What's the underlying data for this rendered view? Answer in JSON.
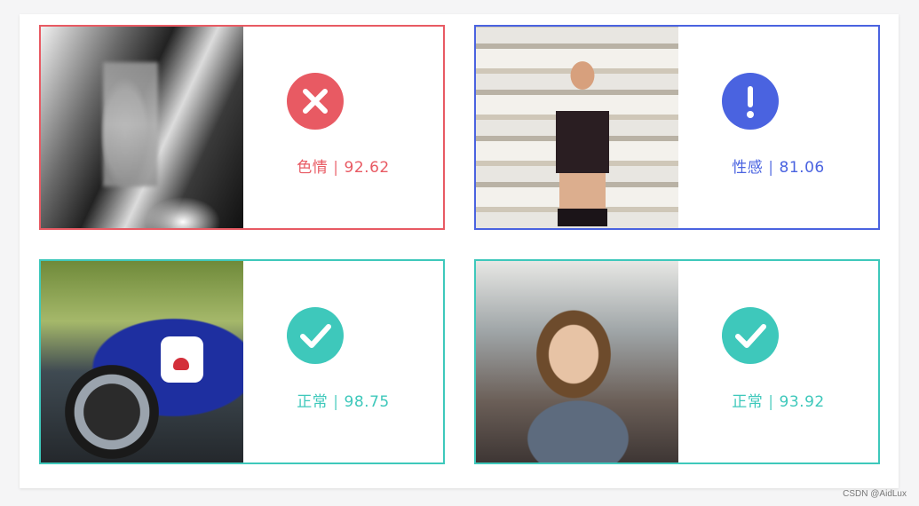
{
  "cards": [
    {
      "label": "色情",
      "separator": "|",
      "score": "92.62",
      "status_icon": "close-icon",
      "color": "#e85a63"
    },
    {
      "label": "性感",
      "separator": "|",
      "score": "81.06",
      "status_icon": "exclamation-icon",
      "color": "#4a63e0"
    },
    {
      "label": "正常",
      "separator": "|",
      "score": "98.75",
      "status_icon": "checkmark-icon",
      "color": "#3ec8bb"
    },
    {
      "label": "正常",
      "separator": "|",
      "score": "93.92",
      "status_icon": "checkmark-icon",
      "color": "#3ec8bb"
    }
  ],
  "colors": {
    "porn": "#e85a63",
    "sexy": "#4a63e0",
    "normal": "#3ec8bb",
    "panel_bg": "#ffffff",
    "page_bg": "#f5f5f6"
  },
  "watermark": "CSDN @AidLux"
}
